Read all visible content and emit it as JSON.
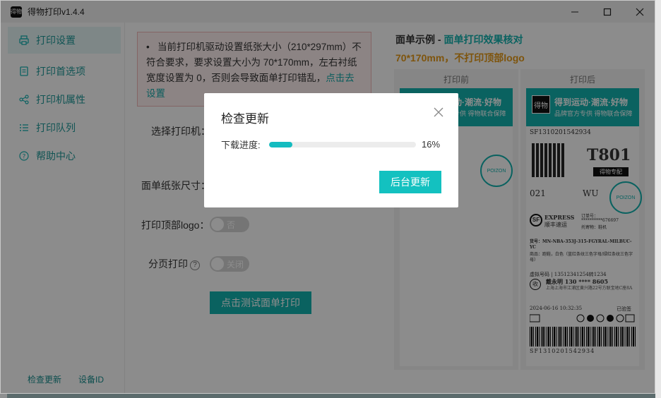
{
  "window": {
    "title": "得物打印v1.4.4",
    "app_icon_text": "得物"
  },
  "sidebar": {
    "items": [
      {
        "label": "打印设置",
        "icon": "printer-icon"
      },
      {
        "label": "打印首选项",
        "icon": "document-icon"
      },
      {
        "label": "打印机属性",
        "icon": "share-nodes-icon"
      },
      {
        "label": "打印队列",
        "icon": "list-icon"
      },
      {
        "label": "帮助中心",
        "icon": "question-circle-icon"
      }
    ],
    "footer_check_update": "检查更新",
    "footer_device_id": "设备ID"
  },
  "main": {
    "warning_bullet": "•",
    "warning_text": "当前打印机驱动设置纸张大小（210*297mm）不符合要求，要求设置大小为 70*170mm，左右衬纸宽度设置为 0，否则会导致面单打印错乱，",
    "warning_link": "点击去设置",
    "select_printer_label": "选择打印机：",
    "paper_size_label": "面单纸张尺寸：",
    "top_logo_label": "打印顶部logo：",
    "top_logo_toggle": "否",
    "paging_label": "分页打印",
    "paging_toggle": "关闭",
    "test_print_button": "点击测试面单打印"
  },
  "sample": {
    "title_prefix": "面单示例 - ",
    "title_highlight": "面单打印效果核对",
    "subtitle": "70*170mm，不打印顶部logo",
    "before_label": "打印前",
    "after_label": "打印后",
    "banner_logo": "得物",
    "banner_line1": "得到运动·潮流·好物",
    "banner_line2": "品牌官方专供 得物联合保障",
    "tracking_no": "SF1310201542934",
    "code_big": "T801",
    "special_tag": "得物专配",
    "region_code": "021",
    "region_wu": "WU",
    "express_name": "EXPRESS",
    "express_cn": "顺丰速运",
    "order_label": "订单号：",
    "order_value": "**********676697",
    "receiver_type": "托寄物：鞋机",
    "sku_line": "货号：MN-NBA-353J-315-FGYRAL-MILBUC-YC",
    "sku_desc": "商品：跑鞋，白色（蓝红条纹三色字母/绿红条纹三色字母）",
    "virtual_no": "虚拟号码 | 13512341254转1234",
    "receiver_name": "戴永明 130 **** 8605",
    "receiver_addr": "上海上海市江浦区黄兴路22号方联宝地C座8A",
    "print_time": "2024-06-16 10:32:35",
    "print_status": "已验签",
    "barcode_text": "SF1310201542934",
    "stamp_text": "POIZON"
  },
  "dialog": {
    "title": "检查更新",
    "progress_label": "下载进度:",
    "progress_value": 0.16,
    "progress_text": "16%",
    "background_update_button": "后台更新"
  },
  "colors": {
    "accent": "#13b3b0",
    "warning_text": "#e69a16",
    "warning_bg": "#fff1f1"
  }
}
